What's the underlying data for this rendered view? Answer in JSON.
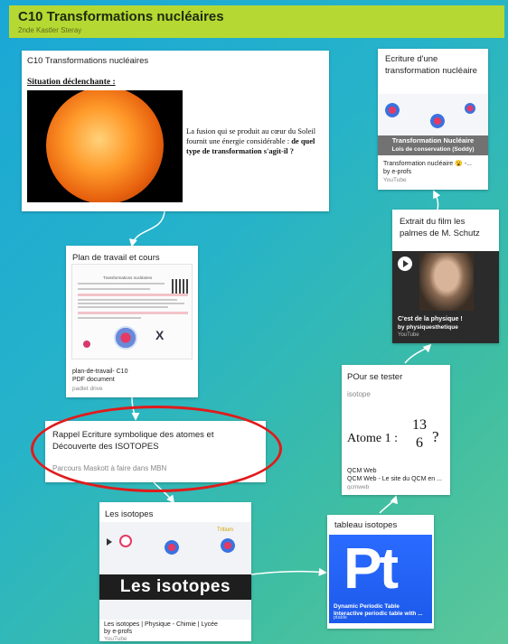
{
  "board": {
    "title": "C10 Transformations nucléaires",
    "subtitle": "2nde Kastler Steray"
  },
  "cards": {
    "situation": {
      "title": "C10 Transformations nucléaires",
      "heading": "Situation déclenchante :",
      "text_plain": "La fusion qui se produit au cœur du Soleil fournit une énergie considérable :",
      "text_bold": "de quel type de transformation s'agit-il ?"
    },
    "plan": {
      "title": "Plan de travail et cours",
      "file_name": "plan-de-travail- C10",
      "file_type": "PDF document",
      "source": "padlet drive",
      "doc_header": "Transformations nucléaires"
    },
    "rappel": {
      "title": "Rappel Ecriture symbolique des atomes et Découverte des ISOTOPES",
      "body": "Parcours Maskott  à faire dans MBN"
    },
    "isotopes": {
      "title": "Les isotopes",
      "banner": "Les isotopes",
      "tritium": "Tritium",
      "video_title": "Les isotopes | Physique - Chimie | Lycée",
      "author": "by e-profs",
      "source": "YouTube"
    },
    "ecriture": {
      "title": "Ecriture d'une transformation nucléaire",
      "ribbon_line1": "Transformation Nucléaire",
      "ribbon_line2": "Lois de conservation (Soddy)",
      "video_title": "Transformation nucléaire 😮 -...",
      "author": "by e-profs",
      "source": "YouTube"
    },
    "extrait": {
      "title": "Extrait du film les palmes de M. Schutz",
      "video_title": "C'est de la physique !",
      "author": "by physiquesthetique",
      "source": "YouTube"
    },
    "tester": {
      "title": "POur se tester",
      "subtitle": "isotope",
      "atome_label": "Atome 1 :",
      "mass_number": "13",
      "atomic_number": "6",
      "question": "?",
      "link_title": "QCM Web",
      "link_desc": "QCM Web - Le site du QCM en ...",
      "source": "qcmweb"
    },
    "tableau": {
      "title": "tableau isotopes",
      "symbol": "Pt",
      "caption1": "Dynamic Periodic Table",
      "caption2": "Interactive periodic table with ...",
      "source": "ptable"
    }
  },
  "colors": {
    "header": "#b6d832",
    "annotation": "#e01b1b",
    "ptable": "#2a6bff"
  }
}
